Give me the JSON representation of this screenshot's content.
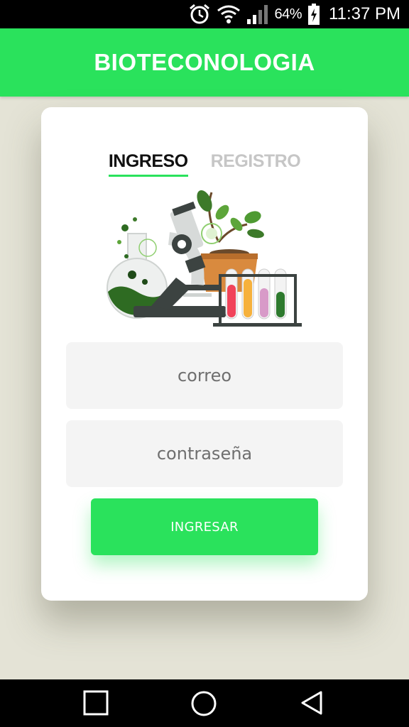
{
  "status_bar": {
    "battery_percent": "64%",
    "time": "11:37 PM",
    "icons": [
      "alarm-icon",
      "wifi-icon",
      "signal-icon",
      "battery-charging-icon"
    ]
  },
  "app_bar": {
    "title": "BIOTECONOLOGIA"
  },
  "tabs": [
    {
      "label": "INGRESO",
      "active": true
    },
    {
      "label": "REGISTRO",
      "active": false
    }
  ],
  "form": {
    "email_placeholder": "correo",
    "password_placeholder": "contraseña",
    "submit_label": "INGRESAR"
  },
  "nav_bar": {
    "icons": [
      "recent-apps-icon",
      "home-icon",
      "back-icon"
    ]
  },
  "colors": {
    "accent": "#2ae25c",
    "background": "#e4e3d6",
    "card": "#ffffff",
    "field": "#f4f4f4"
  }
}
